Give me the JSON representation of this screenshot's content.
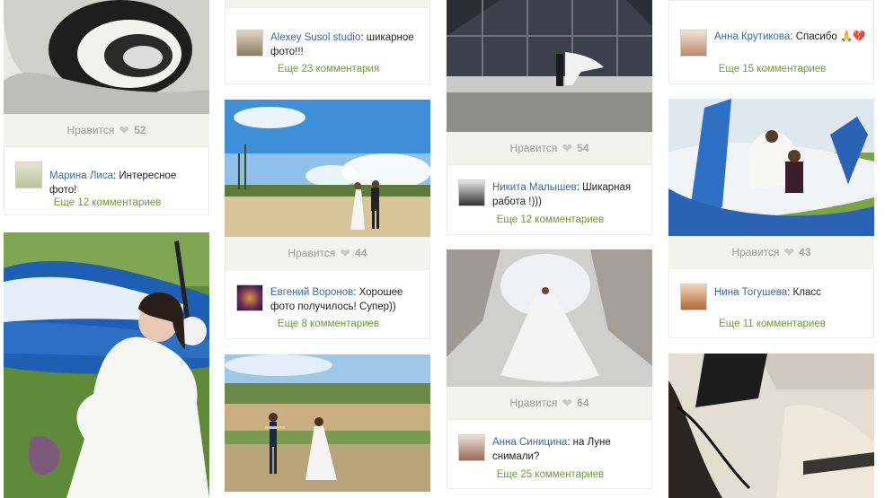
{
  "like_label": "Нравится",
  "posts": {
    "c1p1": {
      "likes": "52",
      "author": "Марина Лиса",
      "text": ": Интересное фото!",
      "more": "Еще 12 комментариев"
    },
    "c2p0": {
      "author": "Alexey Susol studio",
      "text": ": шикарное фото!!!",
      "more": "Еще 23 комментария"
    },
    "c2p1": {
      "likes": "44",
      "author": "Евгений Воронов",
      "text": ": Хорошее фото получилось! Супер))",
      "more": "Еще 8 комментариев"
    },
    "c3p0": {
      "likes": "54",
      "author": "Никита Малышев",
      "text": ": Шикарная работа !)))",
      "more": "Еще 12 комментариев"
    },
    "c3p1": {
      "likes": "64",
      "author": "Анна Синицина",
      "text": ": на Луне снимали?",
      "more": "Еще 25 комментариев"
    },
    "c4p0": {
      "author": "Анна Крутикова",
      "text": ": Спасибо 🙏💔",
      "more": "Еще 15 комментариев"
    },
    "c4p1": {
      "likes": "43",
      "author": "Нина Тогушева",
      "text": ": Класс",
      "more": "Еще 11 комментариев"
    }
  },
  "icons": {
    "like": "heart-icon"
  },
  "colors": {
    "author": "#3b67a1",
    "more": "#6f9a3a",
    "likes_bg": "#f2f2ef"
  }
}
